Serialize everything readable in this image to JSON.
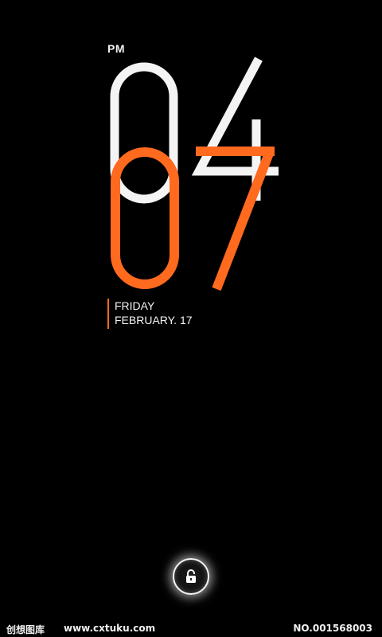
{
  "lockscreen": {
    "ampm": "PM",
    "hour": "04",
    "minute": "07",
    "day": "FRIDAY",
    "date": "FEBRUARY. 17",
    "colors": {
      "background": "#000000",
      "hour": "#f4f4f4",
      "minute": "#ff6a1f",
      "accent": "#ff6a1f"
    },
    "unlock_icon": "lock-open-icon"
  },
  "watermark": {
    "brand": "创想图库",
    "url": "www.cxtuku.com",
    "number": "NO.001568003"
  }
}
